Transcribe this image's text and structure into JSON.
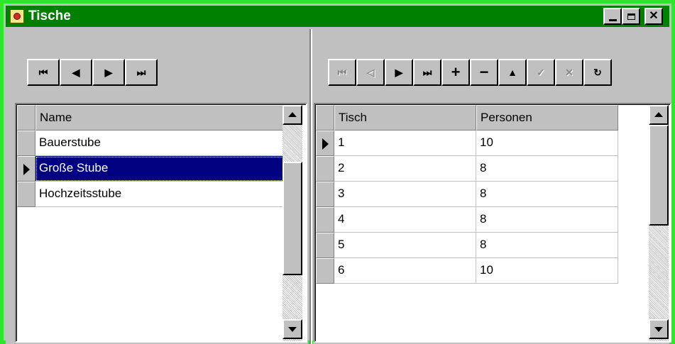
{
  "window": {
    "title": "Tische",
    "caption_buttons": {
      "minimize": "_",
      "maximize": "□",
      "close": "✕"
    },
    "colors": {
      "title_bar": "#008000",
      "window_border": "#2ee62e",
      "face": "#c0c0c0",
      "selection": "#000080"
    }
  },
  "left_navigator": {
    "buttons": [
      {
        "name": "first",
        "glyph": "⏮"
      },
      {
        "name": "prior",
        "glyph": "◀"
      },
      {
        "name": "next",
        "glyph": "▶"
      },
      {
        "name": "last",
        "glyph": "⏭"
      }
    ]
  },
  "right_navigator": {
    "buttons": [
      {
        "name": "first",
        "glyph": "⏮",
        "enabled": false
      },
      {
        "name": "prior",
        "glyph": "◁",
        "enabled": false
      },
      {
        "name": "next",
        "glyph": "▶",
        "enabled": true
      },
      {
        "name": "last",
        "glyph": "⏭",
        "enabled": true
      },
      {
        "name": "insert",
        "glyph": "+",
        "enabled": true
      },
      {
        "name": "delete",
        "glyph": "−",
        "enabled": true
      },
      {
        "name": "edit",
        "glyph": "▲",
        "enabled": true
      },
      {
        "name": "post",
        "glyph": "✓",
        "enabled": false
      },
      {
        "name": "cancel",
        "glyph": "✕",
        "enabled": false
      },
      {
        "name": "refresh",
        "glyph": "↻",
        "enabled": true
      }
    ]
  },
  "rooms_grid": {
    "columns": [
      "Name"
    ],
    "rows": [
      {
        "name": "Bauerstube",
        "current": false
      },
      {
        "name": "Große Stube",
        "current": true
      },
      {
        "name": "Hochzeitsstube",
        "current": false
      }
    ]
  },
  "tables_grid": {
    "columns": [
      "Tisch",
      "Personen"
    ],
    "rows": [
      {
        "tisch": "1",
        "personen": "10",
        "current": true
      },
      {
        "tisch": "2",
        "personen": "8",
        "current": false
      },
      {
        "tisch": "3",
        "personen": "8",
        "current": false
      },
      {
        "tisch": "4",
        "personen": "8",
        "current": false
      },
      {
        "tisch": "5",
        "personen": "8",
        "current": false
      },
      {
        "tisch": "6",
        "personen": "10",
        "current": false
      }
    ]
  }
}
